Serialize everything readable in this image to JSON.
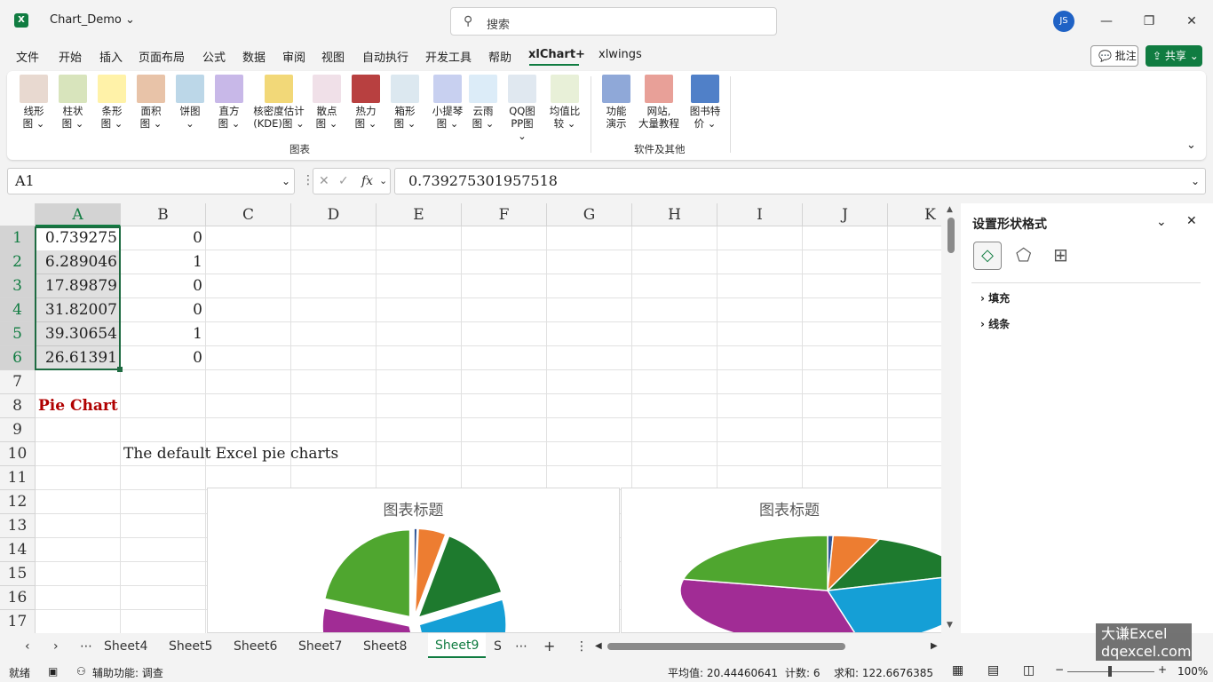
{
  "window": {
    "app_icon": "X",
    "doc_title": "Chart_Demo",
    "search_placeholder": "搜索",
    "avatar": "JS"
  },
  "menu": {
    "tabs": [
      "文件",
      "开始",
      "插入",
      "页面布局",
      "公式",
      "数据",
      "审阅",
      "视图",
      "自动执行",
      "开发工具",
      "帮助",
      "xlChart+",
      "xlwings"
    ],
    "active": "xlChart+",
    "comment_label": "批注",
    "share_label": "共享"
  },
  "ribbon": {
    "charts_group_label": "图表",
    "other_group_label": "软件及其他",
    "buttons": [
      {
        "l1": "线形",
        "l2": "图 ⌄"
      },
      {
        "l1": "柱状",
        "l2": "图 ⌄"
      },
      {
        "l1": "条形",
        "l2": "图 ⌄"
      },
      {
        "l1": "面积",
        "l2": "图 ⌄"
      },
      {
        "l1": "饼图",
        "l2": "⌄"
      },
      {
        "l1": "直方",
        "l2": "图 ⌄"
      },
      {
        "l1": "核密度估计",
        "l2": "(KDE)图 ⌄"
      },
      {
        "l1": "散点",
        "l2": "图 ⌄"
      },
      {
        "l1": "热力",
        "l2": "图 ⌄"
      },
      {
        "l1": "箱形",
        "l2": "图 ⌄"
      },
      {
        "l1": "小提琴",
        "l2": "图 ⌄"
      },
      {
        "l1": "云雨",
        "l2": "图 ⌄"
      },
      {
        "l1": "QQ图",
        "l2": "PP图 ⌄"
      },
      {
        "l1": "均值比",
        "l2": "较 ⌄"
      },
      {
        "l1": "功能",
        "l2": "演示"
      },
      {
        "l1": "网站,",
        "l2": "大量教程"
      },
      {
        "l1": "图书特",
        "l2": "价 ⌄"
      }
    ]
  },
  "formula_bar": {
    "name_box": "A1",
    "fx": "fx",
    "value": "0.739275301957518"
  },
  "grid": {
    "columns": [
      "A",
      "B",
      "C",
      "D",
      "E",
      "F",
      "G",
      "H",
      "I",
      "J",
      "K"
    ],
    "rows": [
      "1",
      "2",
      "3",
      "4",
      "5",
      "6",
      "7",
      "8",
      "9",
      "10",
      "11",
      "12",
      "13",
      "14",
      "15",
      "16",
      "17"
    ],
    "col_a": [
      "0.739275",
      "6.289046",
      "17.89879",
      "31.82007",
      "39.30654",
      "26.61391"
    ],
    "col_b": [
      "0",
      "1",
      "0",
      "0",
      "1",
      "0"
    ],
    "a8": "Pie Chart",
    "b10": "The default Excel pie charts"
  },
  "charts": [
    {
      "title": "图表标题"
    },
    {
      "title": "图表标题"
    }
  ],
  "chart_data": [
    {
      "type": "pie",
      "title": "图表标题",
      "values": [
        0.739275,
        6.289046,
        17.89879,
        31.82007,
        39.30654,
        26.61391
      ],
      "colors": [
        "#2f5597",
        "#ed7d31",
        "#1e7a2e",
        "#159fd6",
        "#a12c95",
        "#4fa62f"
      ],
      "exploded": true
    },
    {
      "type": "pie",
      "title": "图表标题",
      "values": [
        0.739275,
        6.289046,
        17.89879,
        31.82007,
        39.30654,
        26.61391
      ],
      "colors": [
        "#2f5597",
        "#ed7d31",
        "#1e7a2e",
        "#159fd6",
        "#a12c95",
        "#4fa62f"
      ],
      "3d": true
    }
  ],
  "pane": {
    "title": "设置形状格式",
    "sections": [
      "填充",
      "线条"
    ]
  },
  "sheets": {
    "tabs": [
      "Sheet4",
      "Sheet5",
      "Sheet6",
      "Sheet7",
      "Sheet8",
      "Sheet9",
      "S"
    ],
    "active": "Sheet9"
  },
  "status": {
    "ready": "就绪",
    "accessibility": "辅助功能: 调查",
    "average": "平均值: 20.44460641",
    "count": "计数: 6",
    "sum": "求和: 122.6676385",
    "zoom": "100%"
  },
  "watermark": {
    "line1": "大谦Excel",
    "line2": "dqexcel.com"
  }
}
